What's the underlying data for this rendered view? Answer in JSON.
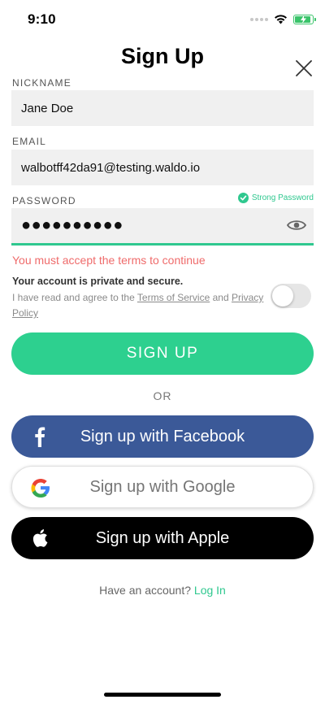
{
  "status_bar": {
    "time": "9:10"
  },
  "header": {
    "title": "Sign Up"
  },
  "form": {
    "nickname": {
      "label": "NICKNAME",
      "value": "Jane Doe"
    },
    "email": {
      "label": "EMAIL",
      "value": "walbotff42da91@testing.waldo.io"
    },
    "password": {
      "label": "PASSWORD",
      "value": "●●●●●●●●●●",
      "strength": "Strong Password"
    },
    "error": "You must accept the terms to continue",
    "privacy_title": "Your account is private and secure.",
    "terms_prefix": "I have read and agree to the ",
    "terms_link": "Terms of Service",
    "terms_and": " and ",
    "privacy_link": "Privacy Policy",
    "terms_accepted": false
  },
  "buttons": {
    "signup": "SIGN UP",
    "or": "OR",
    "facebook": "Sign up with Facebook",
    "google": "Sign up with Google",
    "apple": "Sign up with Apple"
  },
  "footer": {
    "prompt": "Have an account? ",
    "login": "Log In"
  },
  "colors": {
    "accent": "#2dd08f",
    "facebook": "#3b5998",
    "error": "#ef6b6b"
  },
  "icons": [
    "signal-icon",
    "wifi-icon",
    "battery-icon",
    "close-icon",
    "check-icon",
    "eye-icon",
    "facebook-icon",
    "google-icon",
    "apple-icon"
  ]
}
